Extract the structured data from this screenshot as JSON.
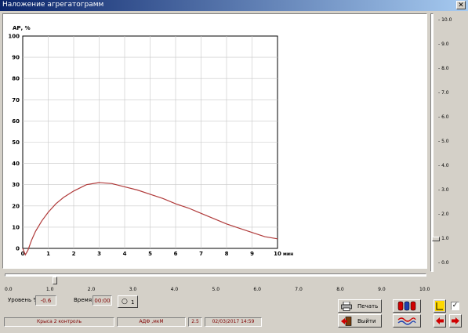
{
  "window": {
    "title": "Наложение агрегатограмм",
    "close_glyph": "✕"
  },
  "chart_data": {
    "type": "line",
    "title": "",
    "ylabel": "АР, %",
    "xlabel": "мин",
    "xlim": [
      0,
      10
    ],
    "ylim": [
      0,
      100
    ],
    "x_ticks": [
      "0",
      "1",
      "2",
      "3",
      "4",
      "5",
      "6",
      "7",
      "8",
      "9",
      "10"
    ],
    "y_ticks": [
      "0",
      "10",
      "20",
      "30",
      "40",
      "50",
      "60",
      "70",
      "80",
      "90",
      "100"
    ],
    "grid": true,
    "series": [
      {
        "color": "#b03a3a",
        "points": [
          [
            0,
            0
          ],
          [
            0.1,
            -3
          ],
          [
            0.2,
            -1
          ],
          [
            0.35,
            4
          ],
          [
            0.5,
            8
          ],
          [
            0.75,
            13
          ],
          [
            1.0,
            17
          ],
          [
            1.3,
            21
          ],
          [
            1.6,
            24
          ],
          [
            2.0,
            27
          ],
          [
            2.5,
            30
          ],
          [
            3.0,
            31
          ],
          [
            3.5,
            30.5
          ],
          [
            4.0,
            29
          ],
          [
            4.5,
            27.5
          ],
          [
            5.0,
            25.5
          ],
          [
            5.5,
            23.5
          ],
          [
            6.0,
            21
          ],
          [
            6.5,
            19
          ],
          [
            7.0,
            16.5
          ],
          [
            7.5,
            14
          ],
          [
            8.0,
            11.5
          ],
          [
            8.5,
            9.5
          ],
          [
            9.0,
            7.5
          ],
          [
            9.5,
            5.5
          ],
          [
            10.0,
            4.5
          ]
        ]
      }
    ]
  },
  "right_scale": {
    "ticks": [
      "10.0",
      "9.0",
      "8.0",
      "7.0",
      "6.0",
      "5.0",
      "4.0",
      "3.0",
      "2.0",
      "1.0",
      "0.0"
    ],
    "thumb_value": 1.0
  },
  "bottom_scale": {
    "ticks": [
      "0.0",
      "1.0",
      "2.0",
      "3.0",
      "4.0",
      "5.0",
      "6.0",
      "7.0",
      "8.0",
      "9.0",
      "10.0"
    ],
    "thumb_value": 1.1
  },
  "controls": {
    "level_label": "Уровень %",
    "level_value": "-0.6",
    "time_label": "Время",
    "time_value": "00:00",
    "counter_label": "1"
  },
  "buttons": {
    "print_label": "Печать",
    "exit_label": "Выйти"
  },
  "status": {
    "subject": "Крыса 2 контроль",
    "reagent": "АДФ ,мкМ",
    "dose": "2.5",
    "datetime": "02/03/2017  14:59"
  },
  "checkbox": {
    "checked": true,
    "glyph": "✓"
  },
  "icons": {
    "printer": "printer-icon",
    "exit": "exit-door-icon",
    "test_tubes": "test-tubes-icon",
    "waves": "waves-icon",
    "marker": "marker-icon",
    "arrow_left": "arrow-left-icon",
    "arrow_right": "arrow-right-icon"
  },
  "colors": {
    "curve": "#b03a3a",
    "title_bar": "#0a246a",
    "status_text": "#800000"
  }
}
